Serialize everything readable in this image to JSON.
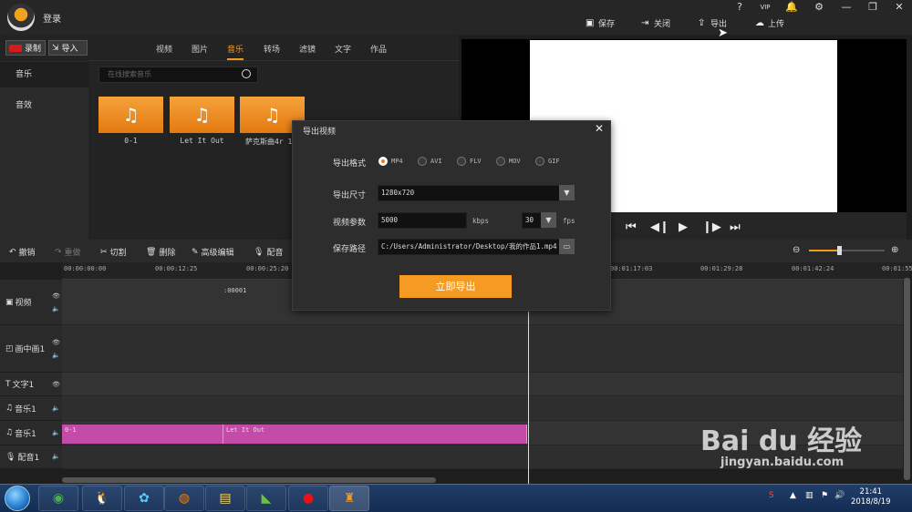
{
  "header": {
    "login": "登录",
    "toolbar": {
      "save": "保存",
      "close": "关闭",
      "export": "导出",
      "upload": "上传"
    },
    "winbtns": {
      "help": "?",
      "vip": "VIP",
      "bell": "🔔",
      "settings": "⚙",
      "minimize": "—",
      "restore": "❐",
      "close": "✕"
    }
  },
  "media": {
    "record": "录制",
    "import": "导入",
    "tabs": [
      "视频",
      "图片",
      "音乐",
      "转场",
      "滤镜",
      "文字",
      "作品"
    ],
    "selected_tab": "音乐",
    "side": [
      "音乐",
      "音效"
    ],
    "search_placeholder": "在线搜索音乐",
    "items": [
      "0-1",
      "Let It Out",
      "萨克斯曲4r 1"
    ]
  },
  "editbar": {
    "undo": "撤销",
    "redo": "重做",
    "cut": "切割",
    "delete": "删除",
    "advanced": "高级编辑",
    "dub": "配音"
  },
  "timeline": {
    "ticks": [
      "00:00:00:00",
      "00:00:12:25",
      "00:00:25:20",
      "00:01:17:03",
      "00:01:29:28",
      "00:01:42:24",
      "00:01:55"
    ],
    "clip_marker": ":00001",
    "tracks": [
      "视频",
      "画中画1",
      "文字1",
      "音乐1",
      "音乐1",
      "配音1"
    ],
    "clips": [
      "0-1",
      "Let It Out"
    ]
  },
  "dialog": {
    "title": "导出视频",
    "format_label": "导出格式",
    "formats": [
      "MP4",
      "AVI",
      "FLV",
      "MOV",
      "GIF"
    ],
    "selected_format": "MP4",
    "size_label": "导出尺寸",
    "size": "1280x720",
    "param_label": "视频参数",
    "bitrate": "5000",
    "bitrate_unit": "kbps",
    "fps": "30",
    "fps_unit": "fps",
    "path_label": "保存路径",
    "path": "C:/Users/Administrator/Desktop/我的作品1.mp4",
    "export_btn": "立即导出"
  },
  "taskbar": {
    "time": "21:41",
    "date": "2018/8/19"
  },
  "watermark": {
    "brand": "Bai du 经验",
    "url": "jingyan.baidu.com"
  }
}
